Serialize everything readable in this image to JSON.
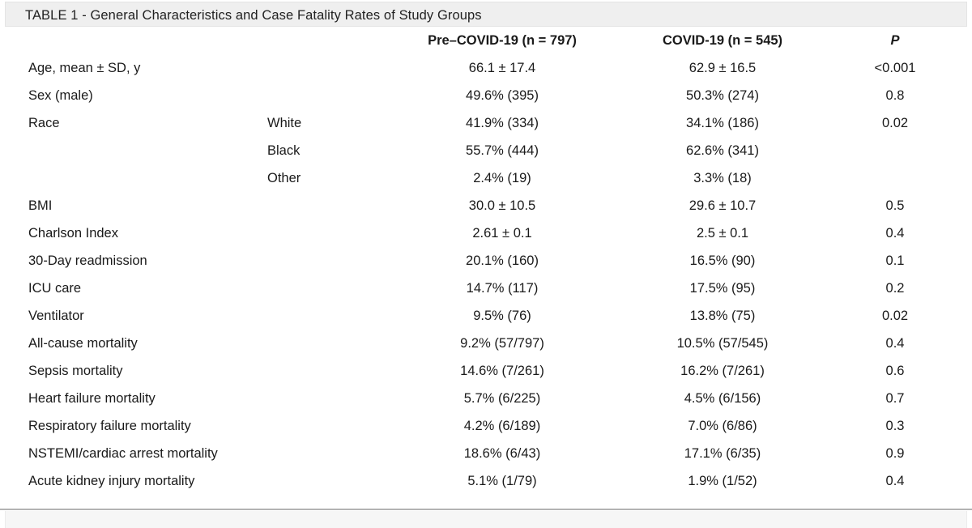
{
  "figure": {
    "caption": "TABLE 1 - General Characteristics and Case Fatality Rates of Study Groups"
  },
  "table": {
    "columns": {
      "label": "",
      "sub": "",
      "pre_covid": "Pre–COVID-19 (n = 797)",
      "covid": "COVID-19 (n = 545)",
      "p": "P"
    },
    "rows": [
      {
        "label": "Age, mean ± SD, y",
        "sub": "",
        "pre_covid": "66.1 ± 17.4",
        "covid": "62.9 ± 16.5",
        "p": "<0.001"
      },
      {
        "label": "Sex (male)",
        "sub": "",
        "pre_covid": "49.6% (395)",
        "covid": "50.3% (274)",
        "p": "0.8"
      },
      {
        "label": "Race",
        "sub": "White",
        "pre_covid": "41.9% (334)",
        "covid": "34.1% (186)",
        "p": "0.02"
      },
      {
        "label": "",
        "sub": "Black",
        "pre_covid": "55.7% (444)",
        "covid": "62.6% (341)",
        "p": ""
      },
      {
        "label": "",
        "sub": "Other",
        "pre_covid": "2.4% (19)",
        "covid": "3.3% (18)",
        "p": ""
      },
      {
        "label": "BMI",
        "sub": "",
        "pre_covid": "30.0 ± 10.5",
        "covid": "29.6 ± 10.7",
        "p": "0.5"
      },
      {
        "label": "Charlson Index",
        "sub": "",
        "pre_covid": "2.61 ± 0.1",
        "covid": "2.5 ± 0.1",
        "p": "0.4"
      },
      {
        "label": "30-Day readmission",
        "sub": "",
        "pre_covid": "20.1% (160)",
        "covid": "16.5% (90)",
        "p": "0.1"
      },
      {
        "label": "ICU care",
        "sub": "",
        "pre_covid": "14.7% (117)",
        "covid": "17.5% (95)",
        "p": "0.2"
      },
      {
        "label": "Ventilator",
        "sub": "",
        "pre_covid": "9.5% (76)",
        "covid": "13.8% (75)",
        "p": "0.02"
      },
      {
        "label": "All-cause mortality",
        "sub": "",
        "pre_covid": "9.2% (57/797)",
        "covid": "10.5% (57/545)",
        "p": "0.4"
      },
      {
        "label": "Sepsis mortality",
        "sub": "",
        "pre_covid": "14.6% (7/261)",
        "covid": "16.2% (7/261)",
        "p": "0.6"
      },
      {
        "label": "Heart failure mortality",
        "sub": "",
        "pre_covid": "5.7% (6/225)",
        "covid": "4.5% (6/156)",
        "p": "0.7"
      },
      {
        "label": "Respiratory failure mortality",
        "sub": "",
        "pre_covid": "4.2% (6/189)",
        "covid": "7.0% (6/86)",
        "p": "0.3"
      },
      {
        "label": "NSTEMI/cardiac arrest mortality",
        "sub": "",
        "pre_covid": "18.6% (6/43)",
        "covid": "17.1% (6/35)",
        "p": "0.9"
      },
      {
        "label": "Acute kidney injury mortality",
        "sub": "",
        "pre_covid": "5.1% (1/79)",
        "covid": "1.9% (1/52)",
        "p": "0.4"
      }
    ]
  }
}
